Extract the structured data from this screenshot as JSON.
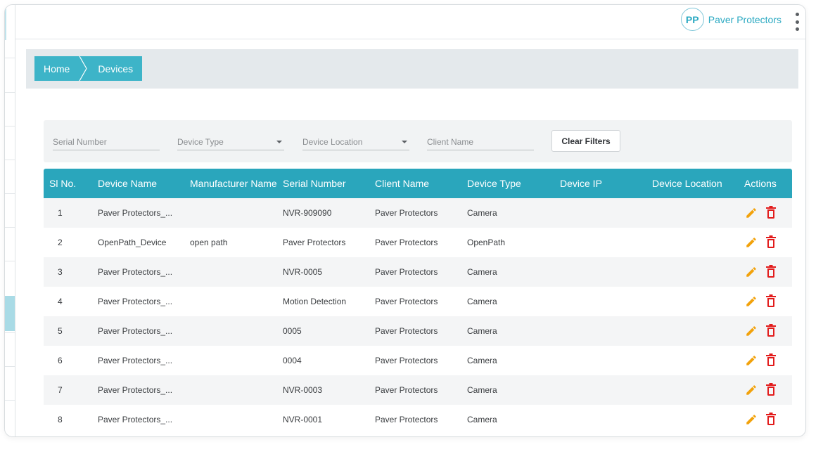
{
  "header": {
    "avatar_initials": "PP",
    "org_name": "Paver Protectors",
    "menu_icon": "more-vert-icon"
  },
  "breadcrumb": [
    {
      "label": "Home"
    },
    {
      "label": "Devices"
    }
  ],
  "filters": {
    "serial_number": {
      "placeholder": "Serial Number"
    },
    "device_type": {
      "placeholder": "Device Type"
    },
    "device_location": {
      "placeholder": "Device Location"
    },
    "client_name": {
      "placeholder": "Client Name"
    },
    "clear_label": "Clear Filters"
  },
  "table": {
    "columns": [
      "Sl No.",
      "Device Name",
      "Manufacturer Name",
      "Serial Number",
      "Client Name",
      "Device Type",
      "Device IP",
      "Device Location",
      "Actions"
    ],
    "rows": [
      {
        "sl": "1",
        "device_name": "Paver Protectors_...",
        "manufacturer": "",
        "serial": "NVR-909090",
        "client": "Paver Protectors",
        "type": "Camera",
        "ip": "",
        "location": ""
      },
      {
        "sl": "2",
        "device_name": "OpenPath_Device",
        "manufacturer": "open path",
        "serial": "Paver Protectors",
        "client": "Paver Protectors",
        "type": "OpenPath",
        "ip": "",
        "location": ""
      },
      {
        "sl": "3",
        "device_name": "Paver Protectors_...",
        "manufacturer": "",
        "serial": "NVR-0005",
        "client": "Paver Protectors",
        "type": "Camera",
        "ip": "",
        "location": ""
      },
      {
        "sl": "4",
        "device_name": "Paver Protectors_...",
        "manufacturer": "",
        "serial": "Motion Detection",
        "client": "Paver Protectors",
        "type": "Camera",
        "ip": "",
        "location": ""
      },
      {
        "sl": "5",
        "device_name": "Paver Protectors_...",
        "manufacturer": "",
        "serial": "0005",
        "client": "Paver Protectors",
        "type": "Camera",
        "ip": "",
        "location": ""
      },
      {
        "sl": "6",
        "device_name": "Paver Protectors_...",
        "manufacturer": "",
        "serial": "0004",
        "client": "Paver Protectors",
        "type": "Camera",
        "ip": "",
        "location": ""
      },
      {
        "sl": "7",
        "device_name": "Paver Protectors_...",
        "manufacturer": "",
        "serial": "NVR-0003",
        "client": "Paver Protectors",
        "type": "Camera",
        "ip": "",
        "location": ""
      },
      {
        "sl": "8",
        "device_name": "Paver Protectors_...",
        "manufacturer": "",
        "serial": "NVR-0001",
        "client": "Paver Protectors",
        "type": "Camera",
        "ip": "",
        "location": ""
      }
    ]
  },
  "colors": {
    "accent": "#2aa6bc",
    "edit_icon": "#f2a20b",
    "delete_icon": "#e21b1b"
  }
}
